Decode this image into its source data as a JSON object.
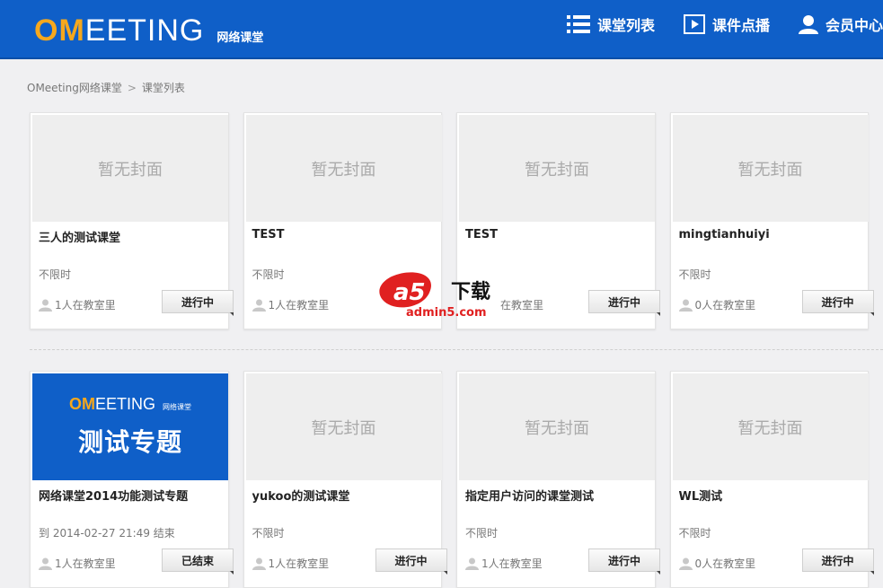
{
  "header": {
    "logo_om": "OM",
    "logo_rest": "EETING",
    "logo_sub": "网络课堂",
    "nav": [
      {
        "label": "课堂列表",
        "icon": "list-icon"
      },
      {
        "label": "课件点播",
        "icon": "play-icon"
      },
      {
        "label": "会员中心",
        "icon": "user-icon"
      }
    ]
  },
  "breadcrumb": {
    "home": "OMeeting网络课堂",
    "separator": ">",
    "current": "课堂列表"
  },
  "placeholder_cover": "暂无封面",
  "cards": [
    {
      "title": "三人的测试课堂",
      "time": "不限时",
      "people": "1人在教室里",
      "status": "进行中"
    },
    {
      "title": "TEST",
      "time": "不限时",
      "people": "1人在教室里",
      "status": ""
    },
    {
      "title": "TEST",
      "time": "",
      "people": "在教室里",
      "status": "进行中"
    },
    {
      "title": "mingtianhuiyi",
      "time": "不限时",
      "people": "0人在教室里",
      "status": "进行中"
    },
    {
      "title": "网络课堂2014功能测试专题",
      "time": "到 2014-02-27 21:49 结束",
      "people": "1人在教室里",
      "status": "已结束",
      "cover_logo_om": "OM",
      "cover_logo_rest": "EETING",
      "cover_logo_sub": "网络课堂",
      "cover_big": "测试专题"
    },
    {
      "title": "yukoo的测试课堂",
      "time": "不限时",
      "people": "1人在教室里",
      "status": "进行中"
    },
    {
      "title": "指定用户访问的课堂测试",
      "time": "不限时",
      "people": "1人在教室里",
      "status": "进行中"
    },
    {
      "title": "WL测试",
      "time": "不限时",
      "people": "0人在教室里",
      "status": "进行中"
    }
  ],
  "watermark": {
    "brand": "a5下载",
    "site": "admin5.com"
  },
  "colors": {
    "header_bg": "#0f5fc8",
    "logo_accent": "#f6a81d"
  }
}
